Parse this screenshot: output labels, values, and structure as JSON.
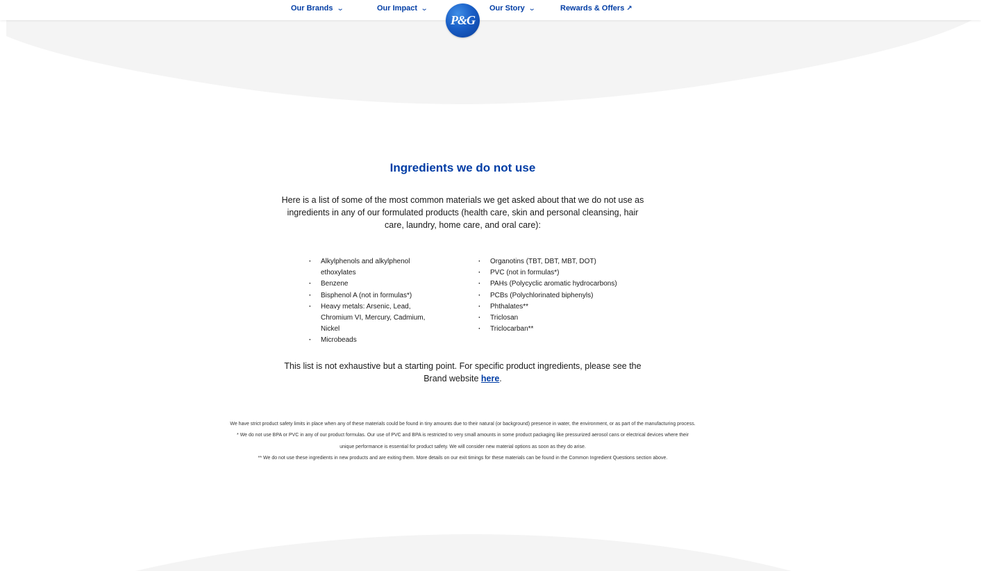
{
  "nav": {
    "items": [
      {
        "label": "Our Brands",
        "icon": "chevron-down-icon"
      },
      {
        "label": "Our Impact",
        "icon": "chevron-down-icon"
      },
      {
        "label": "Our Story",
        "icon": "chevron-down-icon"
      },
      {
        "label": "Rewards & Offers",
        "icon": "external-arrow-icon"
      }
    ],
    "logo_text": "P&G"
  },
  "section": {
    "title": "Ingredients we do not use",
    "intro": "Here is a list of some of the most common materials we get asked about that we do not use as ingredients in any of our formulated products (health care, skin and personal cleansing, hair care, laundry, home care, and oral care):",
    "list_left": [
      "Alkylphenols and alkylphenol ethoxylates",
      "Benzene",
      "Bisphenol A (not in formulas*)",
      "Heavy metals: Arsenic, Lead, Chromium VI, Mercury, Cadmium, Nickel",
      "Microbeads"
    ],
    "list_right": [
      "Organotins (TBT, DBT, MBT, DOT)",
      "PVC (not in formulas*)",
      "PAHs (Polycyclic aromatic hydrocarbons)",
      "PCBs (Polychlorinated biphenyls)",
      "Phthalates**",
      "Triclosan",
      "Triclocarban**"
    ],
    "closing_text": "This list is not exhaustive but a starting point. For specific product ingredients, please see the Brand website ",
    "closing_link": "here",
    "closing_end": ".",
    "footnotes": [
      "We have strict product safety limits in place when any of these materials could be found in tiny amounts due to their natural (or background) presence in water, the environment, or as part of the manufacturing process.",
      "* We do not use BPA or PVC in any of our product formulas. Our use of PVC and BPA is restricted to very small amounts in some product packaging like pressurized aerosol cans or electrical devices where their unique performance is essential for product safety. We will consider new material options as soon as they do arise.",
      "** We do not use these ingredients in new products and are exiting them. More details on our exit timings for these materials can be found in the Common Ingredient Questions section above."
    ]
  },
  "colors": {
    "brand_blue": "#003da5",
    "curve_gray": "#f4f4f4"
  }
}
